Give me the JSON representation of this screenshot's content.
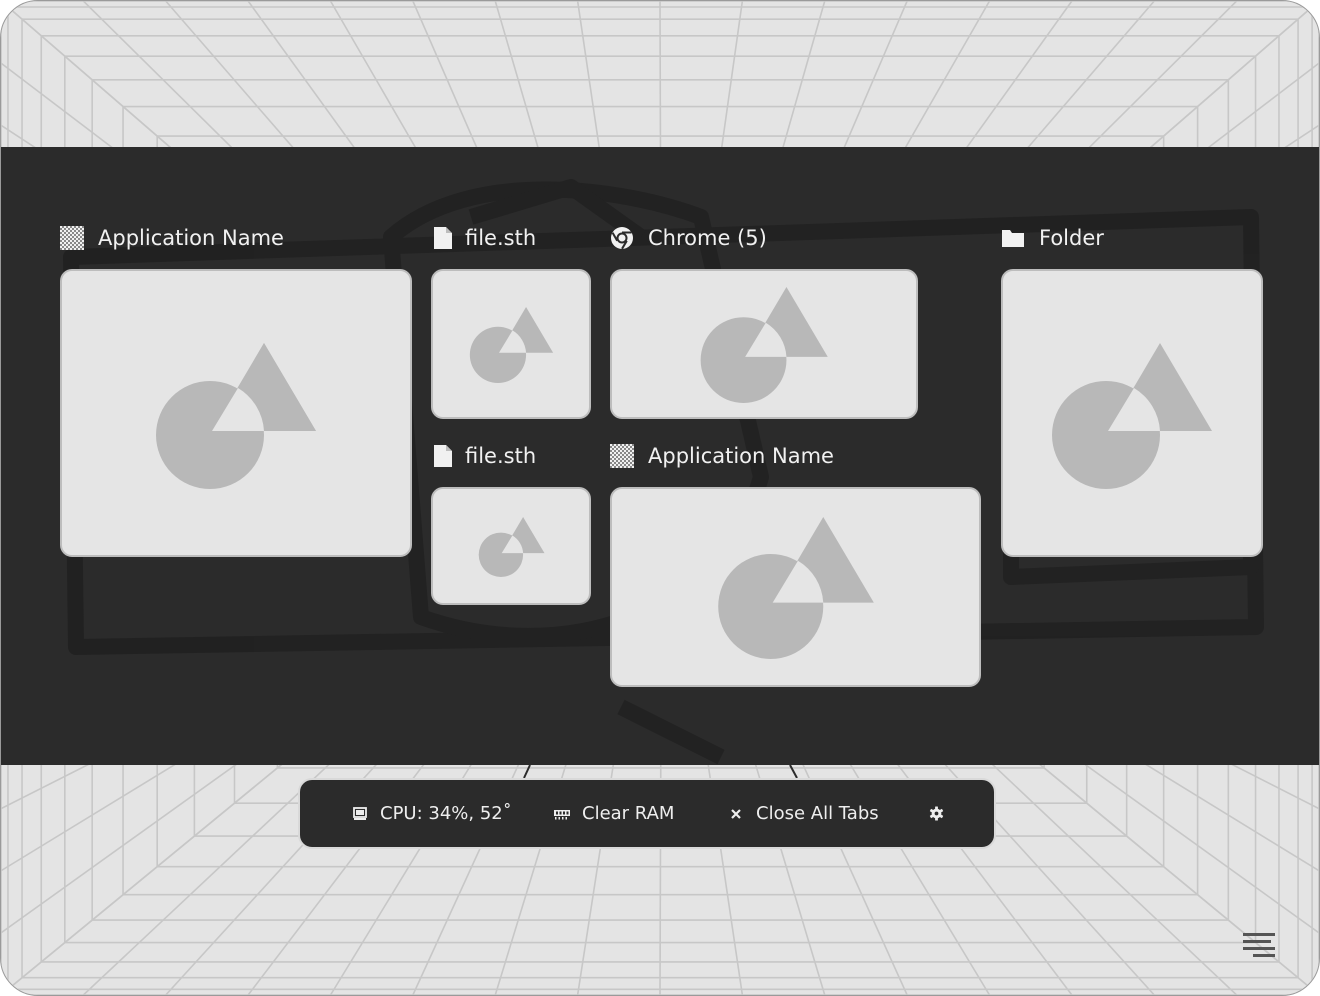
{
  "colors": {
    "overlay": "#2b2b2b",
    "thumbnail": "#e5e5e5",
    "placeholder_shape": "#b8b8b8",
    "text": "#f1f1f1",
    "grid_line": "#c7c7c7"
  },
  "windows": [
    {
      "id": "w1",
      "title": "Application Name",
      "icon": "app-checker-icon"
    },
    {
      "id": "w2",
      "title": "file.sth",
      "icon": "file-icon"
    },
    {
      "id": "w3",
      "title": "Chrome (5)",
      "icon": "chrome-icon"
    },
    {
      "id": "w4",
      "title": "Folder",
      "icon": "folder-icon"
    },
    {
      "id": "w5",
      "title": "file.sth",
      "icon": "file-icon"
    },
    {
      "id": "w6",
      "title": "Application Name",
      "icon": "app-checker-icon"
    }
  ],
  "dock": {
    "cpu_label": "CPU: 34%, 52˚",
    "cpu_icon": "monitor-icon",
    "clear_ram_label": "Clear RAM",
    "clear_ram_icon": "memory-icon",
    "close_tabs_label": "Close All Tabs",
    "close_tabs_icon": "close-icon",
    "settings_icon": "gear-icon"
  },
  "menu_icon": "menu-icon"
}
